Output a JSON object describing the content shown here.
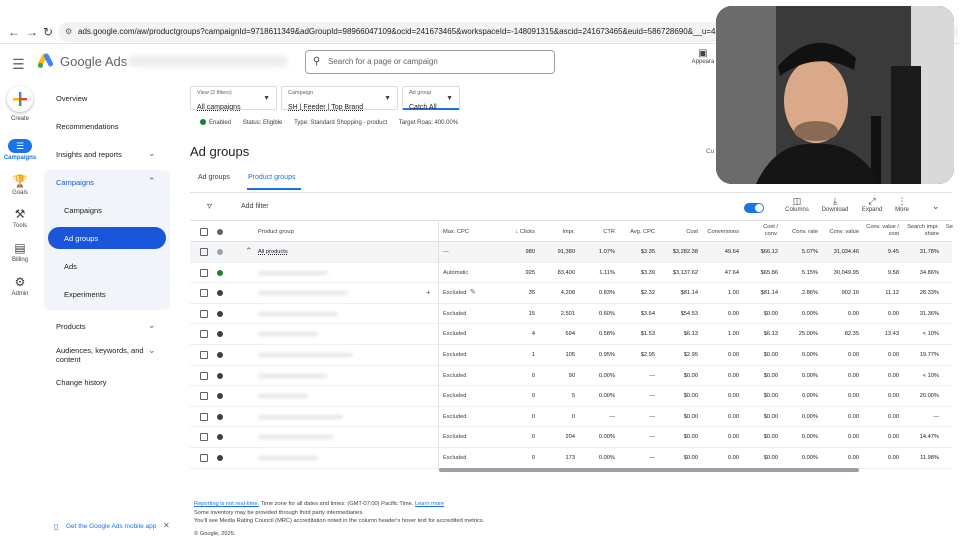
{
  "browser": {
    "url": "ads.google.com/aw/productgroups?campaignId=9718611349&adGroupId=98966047109&ocid=241673465&workspaceId=-148091315&ascid=241673465&euid=586728690&__u=4163107810&"
  },
  "header": {
    "product_name": "Google Ads",
    "search_placeholder": "Search for a page or campaign",
    "appearance_label": "Appeara"
  },
  "rail": {
    "create": "Create",
    "campaigns": "Campaigns",
    "goals": "Goals",
    "tools": "Tools",
    "billing": "Billing",
    "admin": "Admin"
  },
  "sidenav": {
    "overview": "Overview",
    "recommendations": "Recommendations",
    "insights": "Insights and reports",
    "campaigns": "Campaigns",
    "campaigns_sub": "Campaigns",
    "ad_groups": "Ad groups",
    "ads": "Ads",
    "experiments": "Experiments",
    "products": "Products",
    "audiences": "Audiences, keywords, and content",
    "change_history": "Change history",
    "mobile_app": "Get the Google Ads mobile app"
  },
  "filters": {
    "view_label": "View (2 filters)",
    "view_value": "All campaigns",
    "campaign_label": "Campaign",
    "campaign_value": "SH | Feeder | Top Brand",
    "adgroup_label": "Ad group",
    "adgroup_value": "Catch All"
  },
  "status": {
    "enabled": "Enabled",
    "status": "Status: Eligible",
    "type": "Type: Standard Shopping - product",
    "target": "Target Roas: 400.00%"
  },
  "page": {
    "title": "Ad groups",
    "title_right": "Cu",
    "tab_adgroups": "Ad groups",
    "tab_productgroups": "Product groups"
  },
  "toolbar": {
    "add_filter": "Add filter",
    "columns": "Columns",
    "download": "Download",
    "expand": "Expand",
    "more": "More"
  },
  "table": {
    "headers": {
      "product_group": "Product group",
      "max_cpc": "Max. CPC",
      "clicks": "Clicks",
      "impr": "Impr.",
      "ctr": "CTR",
      "avg_cpc": "Avg. CPC",
      "cost": "Cost",
      "conversions": "Conversions",
      "cost_conv": "Cost / conv.",
      "conv_rate": "Conv. rate",
      "conv_value": "Conv. value",
      "conv_value_cost": "Conv. value / cost",
      "search_impr_share": "Search impr. share",
      "cut": "Se"
    },
    "total_row": {
      "name": "All products",
      "max_cpc": "—",
      "clicks": "980",
      "impr": "91,380",
      "ctr": "1.07%",
      "avg_cpc": "$3.35",
      "cost": "$3,282.38",
      "conversions": "49.64",
      "cost_conv": "$66.12",
      "conv_rate": "5.07%",
      "conv_value": "31,034.46",
      "conv_value_cost": "9.45",
      "search_impr_share": "31.78%"
    },
    "rows": [
      {
        "status": "green",
        "max_cpc": "Automatic",
        "clicks": "925",
        "impr": "83,400",
        "ctr": "1.11%",
        "avg_cpc": "$3.39",
        "cost": "$3,137.62",
        "conversions": "47.64",
        "cost_conv": "$65.86",
        "conv_rate": "5.15%",
        "conv_value": "30,049.95",
        "conv_value_cost": "9.58",
        "search_impr_share": "34.86%"
      },
      {
        "status": "excluded",
        "max_cpc": "Excluded",
        "clicks": "35",
        "impr": "4,208",
        "ctr": "0.83%",
        "avg_cpc": "$2.32",
        "cost": "$81.14",
        "conversions": "1.00",
        "cost_conv": "$81.14",
        "conv_rate": "2.86%",
        "conv_value": "902.16",
        "conv_value_cost": "11.12",
        "search_impr_share": "28.33%"
      },
      {
        "status": "excluded",
        "max_cpc": "Excluded",
        "clicks": "15",
        "impr": "2,501",
        "ctr": "0.60%",
        "avg_cpc": "$3.64",
        "cost": "$54.53",
        "conversions": "0.00",
        "cost_conv": "$0.00",
        "conv_rate": "0.00%",
        "conv_value": "0.00",
        "conv_value_cost": "0.00",
        "search_impr_share": "31.36%"
      },
      {
        "status": "excluded",
        "max_cpc": "Excluded",
        "clicks": "4",
        "impr": "694",
        "ctr": "0.58%",
        "avg_cpc": "$1.53",
        "cost": "$6.13",
        "conversions": "1.00",
        "cost_conv": "$6.13",
        "conv_rate": "25.00%",
        "conv_value": "82.35",
        "conv_value_cost": "13.43",
        "search_impr_share": "< 10%"
      },
      {
        "status": "excluded",
        "max_cpc": "Excluded",
        "clicks": "1",
        "impr": "105",
        "ctr": "0.95%",
        "avg_cpc": "$2.95",
        "cost": "$2.95",
        "conversions": "0.00",
        "cost_conv": "$0.00",
        "conv_rate": "0.00%",
        "conv_value": "0.00",
        "conv_value_cost": "0.00",
        "search_impr_share": "19.77%"
      },
      {
        "status": "excluded",
        "max_cpc": "Excluded",
        "clicks": "0",
        "impr": "90",
        "ctr": "0.00%",
        "avg_cpc": "—",
        "cost": "$0.00",
        "conversions": "0.00",
        "cost_conv": "$0.00",
        "conv_rate": "0.00%",
        "conv_value": "0.00",
        "conv_value_cost": "0.00",
        "search_impr_share": "< 10%"
      },
      {
        "status": "excluded",
        "max_cpc": "Excluded",
        "clicks": "0",
        "impr": "5",
        "ctr": "0.00%",
        "avg_cpc": "—",
        "cost": "$0.00",
        "conversions": "0.00",
        "cost_conv": "$0.00",
        "conv_rate": "0.00%",
        "conv_value": "0.00",
        "conv_value_cost": "0.00",
        "search_impr_share": "20.00%"
      },
      {
        "status": "excluded",
        "max_cpc": "Excluded",
        "clicks": "0",
        "impr": "0",
        "ctr": "—",
        "avg_cpc": "—",
        "cost": "$0.00",
        "conversions": "0.00",
        "cost_conv": "$0.00",
        "conv_rate": "0.00%",
        "conv_value": "0.00",
        "conv_value_cost": "0.00",
        "search_impr_share": "—"
      },
      {
        "status": "excluded",
        "max_cpc": "Excluded",
        "clicks": "0",
        "impr": "204",
        "ctr": "0.00%",
        "avg_cpc": "—",
        "cost": "$0.00",
        "conversions": "0.00",
        "cost_conv": "$0.00",
        "conv_rate": "0.00%",
        "conv_value": "0.00",
        "conv_value_cost": "0.00",
        "search_impr_share": "14.47%"
      },
      {
        "status": "excluded",
        "max_cpc": "Excluded",
        "clicks": "0",
        "impr": "173",
        "ctr": "0.00%",
        "avg_cpc": "—",
        "cost": "$0.00",
        "conversions": "0.00",
        "cost_conv": "$0.00",
        "conv_rate": "0.00%",
        "conv_value": "0.00",
        "conv_value_cost": "0.00",
        "search_impr_share": "11.98%"
      }
    ]
  },
  "footer": {
    "realtime_link": "Reporting is not real-time.",
    "timezone": " Time zone for all dates and times: (GMT-07:00) Pacific Time.",
    "learn_more": "Learn more",
    "line2": "Some inventory may be provided through third party intermediaries.",
    "line3": "You'll see Media Rating Council (MRC) accreditation noted in the column header's hover text for accredited metrics.",
    "copyright": "© Google, 2025."
  },
  "colors": {
    "accent": "#1a73e8",
    "active_nav": "#1a56db",
    "enabled_green": "#188038"
  }
}
